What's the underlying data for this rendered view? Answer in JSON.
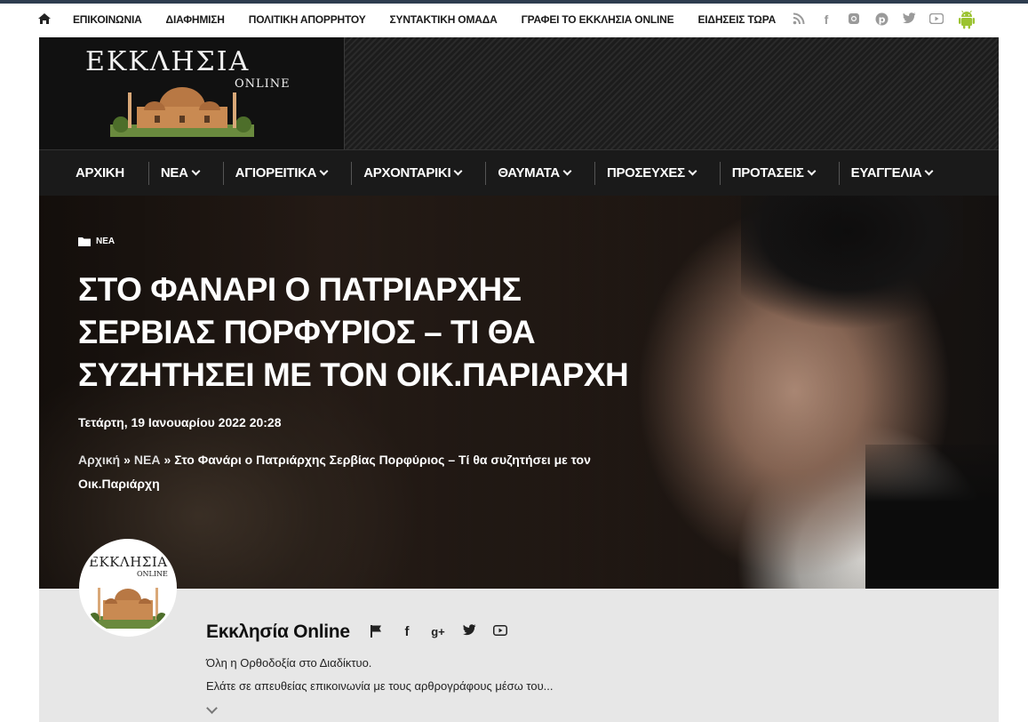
{
  "topnav": {
    "items": [
      "ΕΠΙΚΟΙΝΩΝΙΑ",
      "ΔΙΑΦΗΜΙΣΗ",
      "ΠΟΛΙΤΙΚΗ ΑΠΟΡΡΗΤΟΥ",
      "ΣΥΝΤΑΚΤΙΚΗ ΟΜΑΔΑ",
      "ΓΡΑΦΕΙ ΤΟ ΕΚΚΛΗΣΙΑ ONLINE",
      "ΕΙΔΗΣΕΙΣ ΤΩΡΑ"
    ],
    "social_icons": [
      "rss-icon",
      "facebook-icon",
      "instagram-icon",
      "pinterest-icon",
      "twitter-icon",
      "youtube-icon",
      "android-icon"
    ]
  },
  "header": {
    "logo_text": "ΕΚΚΛΗΣΙΑ",
    "logo_sub": "ONLINE"
  },
  "mainnav": {
    "items": [
      {
        "label": "ΑΡΧΙΚΗ",
        "dropdown": false
      },
      {
        "label": "ΝΕΑ",
        "dropdown": true
      },
      {
        "label": "ΑΓΙΟΡΕΙΤΙΚΑ",
        "dropdown": true
      },
      {
        "label": "ΑΡΧΟΝΤΑΡΙΚΙ",
        "dropdown": true
      },
      {
        "label": "ΘΑΥΜΑΤΑ",
        "dropdown": true
      },
      {
        "label": "ΠΡΟΣΕΥΧΕΣ",
        "dropdown": true
      },
      {
        "label": "ΠΡΟΤΑΣΕΙΣ",
        "dropdown": true
      },
      {
        "label": "ΕΥΑΓΓΕΛΙΑ",
        "dropdown": true
      }
    ]
  },
  "article": {
    "category": "ΝΕΑ",
    "title": "ΣΤΟ ΦΑΝΑΡΙ Ο ΠΑΤΡΙΑΡΧΗΣ ΣΕΡΒΙΑΣ ΠΟΡΦΥΡΙΟΣ – ΤΙ ΘΑ ΣΥΖΗΤΗΣΕΙ ΜΕ ΤΟΝ ΟΙΚ.ΠΑΡΙΑΡΧΗ",
    "date": "Τετάρτη, 19 Ιανουαρίου 2022 20:28",
    "breadcrumb": {
      "home": "Αρχική",
      "category": "ΝΕΑ",
      "separator": "»",
      "current": "Στο Φανάρι ο Πατριάρχης Σερβίας Πορφύριος – Τί θα συζητήσει με τον Οικ.Παριάρχη"
    }
  },
  "author": {
    "avatar_text": "ΕΚΚΛΗΣΙΑ",
    "avatar_sub": "ONLINE",
    "name": "Εκκλησία Online",
    "icons": [
      "flag-icon",
      "facebook-icon",
      "google-plus-icon",
      "twitter-icon",
      "youtube-icon"
    ],
    "desc_line1": "Όλη η Ορθοδοξία στο Διαδίκτυο.",
    "desc_line2": "Ελάτε σε απευθείας επικοινωνία με τους αρθρογράφους μέσω του..."
  }
}
